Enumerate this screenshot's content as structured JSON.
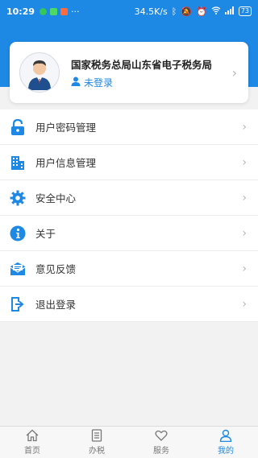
{
  "status_bar": {
    "time": "10:29",
    "network_speed": "34.5K/s",
    "battery": "73"
  },
  "profile": {
    "org_name": "国家税务总局山东省电子税务局",
    "login_status": "未登录"
  },
  "menu": [
    {
      "label": "用户密码管理",
      "icon": "lock-icon"
    },
    {
      "label": "用户信息管理",
      "icon": "building-icon"
    },
    {
      "label": "安全中心",
      "icon": "gear-icon"
    },
    {
      "label": "关于",
      "icon": "info-icon"
    },
    {
      "label": "意见反馈",
      "icon": "mail-icon"
    },
    {
      "label": "退出登录",
      "icon": "logout-icon"
    }
  ],
  "tabs": [
    {
      "label": "首页",
      "icon": "home-icon"
    },
    {
      "label": "办税",
      "icon": "document-icon"
    },
    {
      "label": "服务",
      "icon": "heart-icon"
    },
    {
      "label": "我的",
      "icon": "user-icon",
      "active": true
    }
  ],
  "colors": {
    "accent": "#1e88e5",
    "header": "#1e88e5"
  }
}
